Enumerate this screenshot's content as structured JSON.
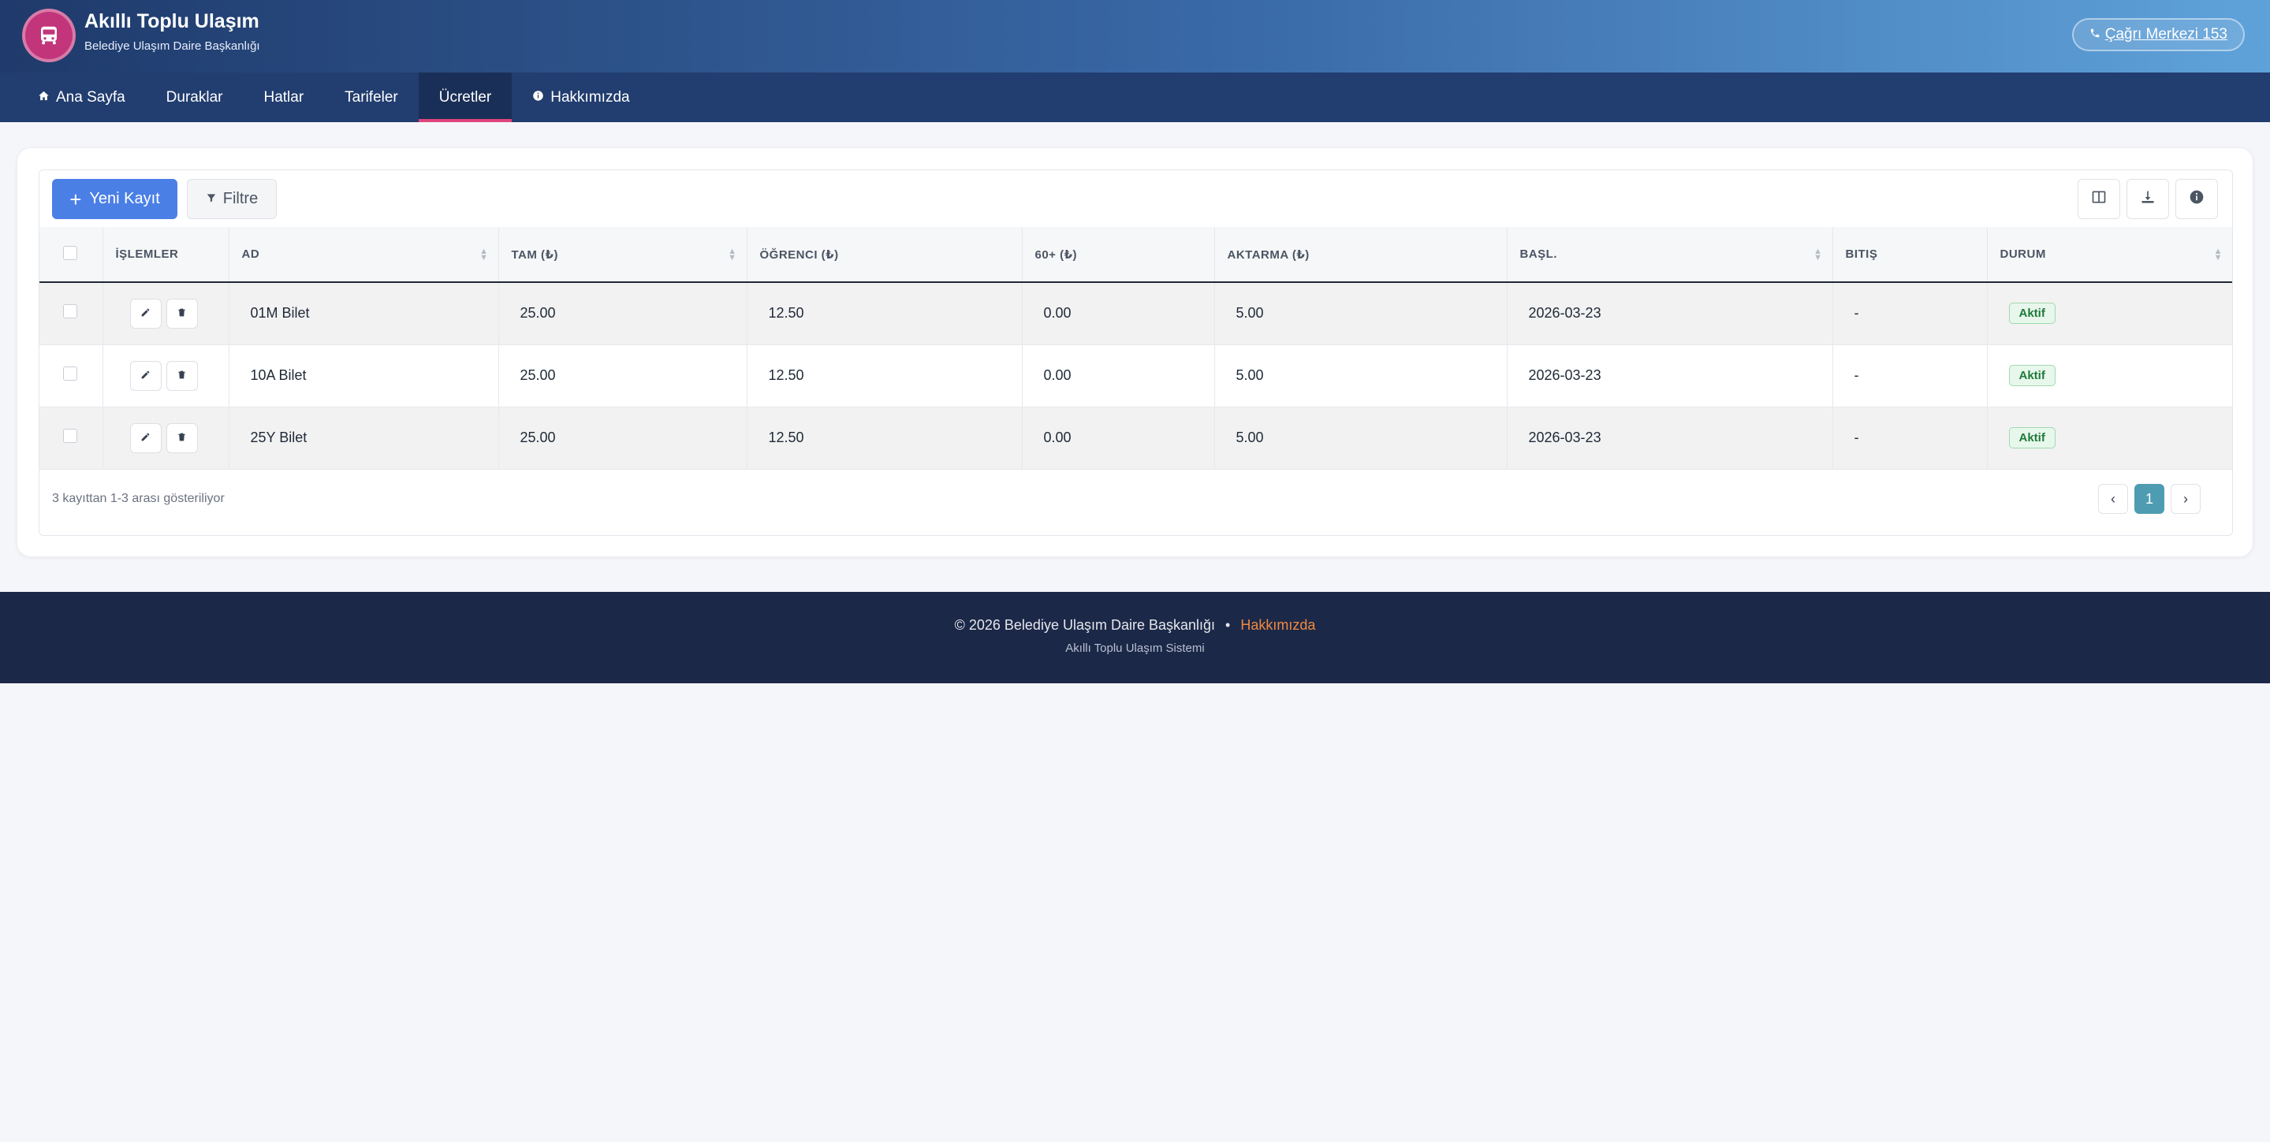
{
  "header": {
    "title": "Akıllı Toplu Ulaşım",
    "subtitle": "Belediye Ulaşım Daire Başkanlığı",
    "call_button": "Çağrı Merkezi 153",
    "logo_icon": "bus-icon"
  },
  "nav": {
    "items": [
      {
        "label": "Ana Sayfa",
        "icon": "home-icon"
      },
      {
        "label": "Duraklar"
      },
      {
        "label": "Hatlar"
      },
      {
        "label": "Tarifeler"
      },
      {
        "label": "Ücretler",
        "active": true
      },
      {
        "label": "Hakkımızda",
        "icon": "info-icon"
      }
    ]
  },
  "toolbar": {
    "new_record": "Yeni Kayıt",
    "filter": "Filtre"
  },
  "table": {
    "headers": [
      "İŞLEMLER",
      "AD",
      "TAM (₺)",
      "ÖĞRENCI (₺)",
      "60+ (₺)",
      "AKTARMA (₺)",
      "BAŞL.",
      "BITIŞ",
      "DURUM"
    ],
    "rows": [
      {
        "ad": "01M Bilet",
        "tam": "25.00",
        "ogrenci": "12.50",
        "altmis": "0.00",
        "aktarma": "5.00",
        "basl": "2026-03-23",
        "bitis": "-",
        "durum": "Aktif"
      },
      {
        "ad": "10A Bilet",
        "tam": "25.00",
        "ogrenci": "12.50",
        "altmis": "0.00",
        "aktarma": "5.00",
        "basl": "2026-03-23",
        "bitis": "-",
        "durum": "Aktif"
      },
      {
        "ad": "25Y Bilet",
        "tam": "25.00",
        "ogrenci": "12.50",
        "altmis": "0.00",
        "aktarma": "5.00",
        "basl": "2026-03-23",
        "bitis": "-",
        "durum": "Aktif"
      }
    ]
  },
  "pagination": {
    "info": "3 kayıttan 1-3 arası gösteriliyor",
    "prev": "‹",
    "current": "1",
    "next": "›"
  },
  "footer": {
    "copyright": "© 2026 Belediye Ulaşım Daire Başkanlığı",
    "separator": "•",
    "about_link": "Hakkımızda",
    "tagline": "Akıllı Toplu Ulaşım Sistemi"
  },
  "colors": {
    "accent": "#4a7fe6",
    "nav_active_underline": "#e0457b",
    "status_active": "#1e7a3a",
    "footer_link": "#f08a3e"
  }
}
